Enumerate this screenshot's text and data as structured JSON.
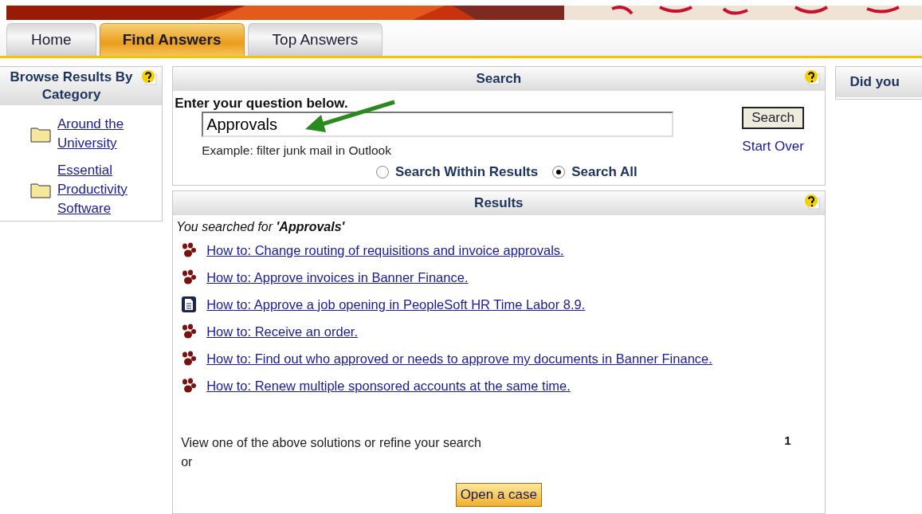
{
  "tabs": [
    {
      "label": "Home",
      "selected": false
    },
    {
      "label": "Find Answers",
      "selected": true
    },
    {
      "label": "Top Answers",
      "selected": false
    }
  ],
  "category_panel": {
    "title": "Browse Results By Category",
    "items": [
      {
        "label": "Around the University"
      },
      {
        "label": "Essential Productivity Software"
      }
    ]
  },
  "search_panel": {
    "title": "Search",
    "prompt": "Enter your question below.",
    "query": "Approvals",
    "example": "Example: filter junk mail in Outlook",
    "button": "Search",
    "start_over": "Start Over",
    "scope": [
      {
        "label": "Search Within Results",
        "selected": false
      },
      {
        "label": "Search All",
        "selected": true
      }
    ]
  },
  "results_panel": {
    "title": "Results",
    "summary": "You searched for **'Approvals'**",
    "results": [
      {
        "kind": "paw",
        "label": "How to: Change routing of requisitions and invoice approvals."
      },
      {
        "kind": "paw",
        "label": "How to: Approve invoices in Banner Finance."
      },
      {
        "kind": "document",
        "label": "How to: Approve a job opening in PeopleSoft HR Time Labor 8.9."
      },
      {
        "kind": "paw",
        "label": "How to: Receive an order."
      },
      {
        "kind": "paw",
        "label": "How to: Find out who approved or needs to approve my documents in Banner Finance."
      },
      {
        "kind": "paw",
        "label": "How to: Renew multiple sponsored accounts at the same time."
      }
    ],
    "footer": "View one of the above solutions or refine your search",
    "or": "or",
    "count": "1",
    "button": "Open a case"
  },
  "side_panel": {
    "title": "Did you"
  }
}
